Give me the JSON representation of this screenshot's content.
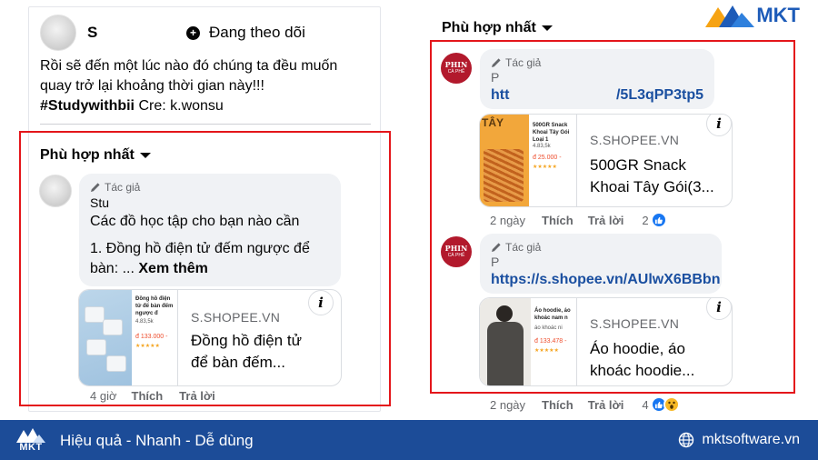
{
  "left_post": {
    "author_name": "S",
    "follow_label": "Đang theo dõi",
    "text_line1": "Rồi sẽ đến một lúc nào đó chúng ta đều muốn",
    "text_line2": "quay trở lại khoảng thời gian này!!!",
    "hashtag": "#Studywithbii",
    "credit": " Cre: k.wonsu",
    "sort_label": "Phù hợp nhất",
    "comment": {
      "author_tag": "Tác giả",
      "author": "Stu",
      "line1": "Các đồ học tập cho bạn nào cần",
      "line2": "1. Đồng hồ điện tử đếm ngược để",
      "line3_prefix": "bàn: ... ",
      "see_more": "Xem thêm",
      "card_domain": "S.SHOPEE.VN",
      "card_title_1": "Đồng hồ điện tử",
      "card_title_2": "để bàn đếm...",
      "thumb_text_1": "Đồng hồ điện tử để bàn đếm ngược đ",
      "thumb_text_2": "4.83,5k",
      "thumb_price": "đ 133.000 -",
      "time": "4 giờ",
      "like": "Thích",
      "reply": "Trả lời"
    }
  },
  "right_post": {
    "sort_label": "Phù hợp nhất",
    "comments": [
      {
        "avatar_text": "PHIN",
        "avatar_sub": "CÀ PHÊ",
        "author_tag": "Tác giả",
        "author": "P",
        "link_start": "htt",
        "link_end": "/5L3qPP3tp5",
        "card_domain": "S.SHOPEE.VN",
        "card_title_1": "500GR Snack",
        "card_title_2": "Khoai Tây Gói(3...",
        "thumb_text_1": "500GR Snack Khoai Tây Gói Loại 1",
        "thumb_text_2": "4.83,5k",
        "thumb_price": "đ 25.000 -",
        "thumb_tag": "TÂY",
        "time": "2 ngày",
        "like": "Thích",
        "reply": "Trả lời",
        "reactions": "2"
      },
      {
        "avatar_text": "PHIN",
        "avatar_sub": "CÀ PHÊ",
        "author_tag": "Tác giả",
        "author": "P",
        "link": "https://s.shopee.vn/AUlwX6BBbn",
        "card_domain": "S.SHOPEE.VN",
        "card_title_1": "Áo hoodie, áo",
        "card_title_2": "khoác hoodie...",
        "thumb_text_1": "Áo hoodie, áo khoác nam n",
        "thumb_text_2": "áo khoác ni",
        "thumb_price": "đ 133.478 -",
        "time": "2 ngày",
        "like": "Thích",
        "reply": "Trả lời",
        "reactions": "4"
      }
    ]
  },
  "brand": {
    "logo_text": "MKT",
    "slogan": "Hiệu quả - Nhanh - Dễ dùng",
    "website": "mktsoftware.vn"
  },
  "colors": {
    "highlight_red": "#e4161b",
    "footer_blue": "#1c4c98",
    "link_blue": "#1a4fa0",
    "like_blue": "#1877f2"
  }
}
